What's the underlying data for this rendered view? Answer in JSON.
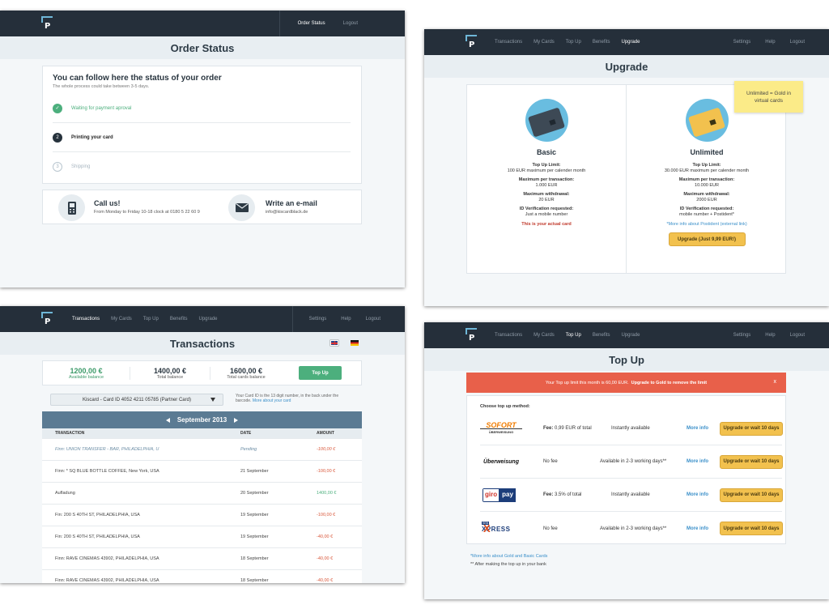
{
  "brand": {
    "logo_letter": "P"
  },
  "order": {
    "nav": {
      "links": [
        "Order Status",
        "Logout"
      ]
    },
    "title": "Order Status",
    "heading": "You can follow here the status of your order",
    "subheading": "The whole process could take between 3-5 days.",
    "steps": [
      {
        "num": "✓",
        "label": "Waiting for payment aproval",
        "state": "done"
      },
      {
        "num": "2",
        "label": "Printing your card",
        "state": "active"
      },
      {
        "num": "3",
        "label": "Shipping",
        "state": "pending"
      }
    ],
    "call_title": "Call us!",
    "call_text": "From Monday to Friday 10-18 clock at 0180 5 22 60 9",
    "email_title": "Write an e-mail",
    "email_text": "info@kiscardblack.de"
  },
  "upgrade": {
    "nav": {
      "links": [
        "Transactions",
        "My Cards",
        "Top Up",
        "Benefits",
        "Upgrade"
      ],
      "right": [
        "Settings",
        "Help",
        "Logout"
      ]
    },
    "title": "Upgrade",
    "note": "Unlimited = Gold in virtual cards",
    "basic": {
      "name": "Basic",
      "lines": [
        [
          "Top Up Limit:",
          "100 EUR maximum per calender month"
        ],
        [
          "Maximum per transaction:",
          "1.000 EUR"
        ],
        [
          "Maximum withdrawal:",
          "20 EUR"
        ],
        [
          "ID Verification requested:",
          "Just a mobile number"
        ]
      ],
      "status": "This is your actual card"
    },
    "unlimited": {
      "name": "Unlimited",
      "lines": [
        [
          "Top Up Limit:",
          "30.000 EUR maximum per calender month"
        ],
        [
          "Maximum per transaction:",
          "10.000 EUR"
        ],
        [
          "Maximum withdrawal:",
          "2000 EUR"
        ],
        [
          "ID Verification requested:",
          "mobile number + Postident*"
        ]
      ],
      "link": "*More info about Postident (external link)",
      "button": "Upgrade (Just 9,99 EUR!)"
    }
  },
  "transactions": {
    "nav": {
      "links": [
        "Transactions",
        "My Cards",
        "Top Up",
        "Benefits",
        "Upgrade"
      ],
      "right": [
        "Settings",
        "Help",
        "Logout"
      ]
    },
    "title": "Transactions",
    "flags": [
      "🇬🇧",
      "🇩🇪"
    ],
    "balances": [
      {
        "value": "1200,00 €",
        "label": "Available balance"
      },
      {
        "value": "1400,00 €",
        "label": "Total balance"
      },
      {
        "value": "1600,00 €",
        "label": "Total cards balance"
      }
    ],
    "topup_button": "Top Up",
    "card_select": "Kiscard - Card ID 4052 4211 05785  (Partner Card)",
    "card_info": "Your Card ID is the 13 digit number, in the back under the barcode.",
    "card_info_link": "More about your card",
    "month": "September 2013",
    "columns": [
      "TRANSACTION",
      "DATE",
      "AMOUNT"
    ],
    "rows": [
      {
        "t": "Finn: UNION TRANSFER - BAR, PHILADELPHIA, U",
        "d": "Pending",
        "a": "-100,00 €",
        "pending": true
      },
      {
        "t": "Finn: * SQ BLUE BOTTLE COFFEE, New York, USA",
        "d": "21 September",
        "a": "-100,00 €"
      },
      {
        "t": "Aufladung",
        "d": "20 September",
        "a": "1400,00 €",
        "positive": true
      },
      {
        "t": "Fin: 200 S 40TH ST, PHILADELPHIA, USA",
        "d": "19 September",
        "a": "-100,00 €"
      },
      {
        "t": "Fin: 200 S 40TH ST, PHILADELPHIA, USA",
        "d": "19 September",
        "a": "-40,00 €"
      },
      {
        "t": "Finn: RAVE CINEMAS 43902, PHILADELPHIA, USA",
        "d": "18 September",
        "a": "-40,00 €"
      },
      {
        "t": "Finn: RAVE CINEMAS 43902, PHILADELPHIA, USA",
        "d": "18 September",
        "a": "-40,00 €"
      }
    ]
  },
  "topup": {
    "nav": {
      "links": [
        "Transactions",
        "My Cards",
        "Top Up",
        "Benefits",
        "Upgrade"
      ],
      "right": [
        "Settings",
        "Help",
        "Logout"
      ]
    },
    "title": "Top Up",
    "alert": "Your Top up limit this month is 60,00 EUR.",
    "alert_strong": "Upgrade to Gold to remove the limit",
    "alert_close": "x",
    "choose": "Choose top up method:",
    "methods": [
      {
        "logo": "SOFORT",
        "logo2": "ÜBERWEISUNG",
        "fee_label": "Fee:",
        "fee": "0,99 EUR of total",
        "avail": "Instantly available",
        "more": "More info",
        "button": "Upgrade or wait 10 days"
      },
      {
        "logo": "Überweisung",
        "fee_label": "",
        "fee": "No fee",
        "avail": "Available in 2-3 working days**",
        "more": "More info",
        "button": "Upgrade or wait 10 days"
      },
      {
        "logo": "giro",
        "logo2": "pay",
        "fee_label": "Fee:",
        "fee": "3.5% of total",
        "avail": "Instantly available",
        "more": "More info",
        "button": "Upgrade or wait 10 days"
      },
      {
        "logo": "XPRESS",
        "logo2": "SEB",
        "fee_label": "",
        "fee": "No fee",
        "avail": "Available in 2-3 working days**",
        "more": "More info",
        "button": "Upgrade or wait 10 days"
      }
    ],
    "foot1": "*More info about Gold and Basic Cards",
    "foot2": "** After making the top up in your bank"
  },
  "colors": {
    "nav": "#252f3a",
    "accent_green": "#4caf7d",
    "gold": "#f2c14e",
    "alert": "#e8604a",
    "link": "#3a8fc9"
  }
}
